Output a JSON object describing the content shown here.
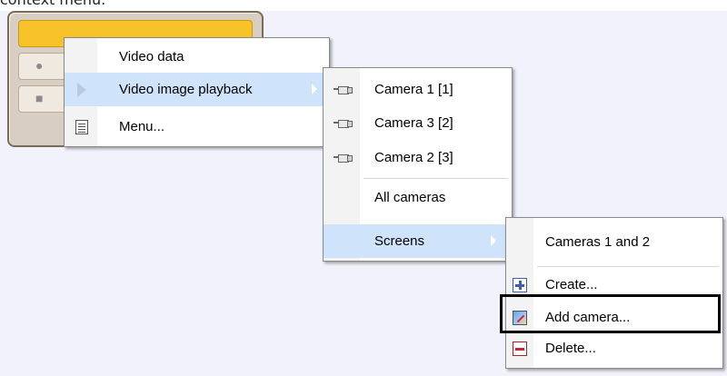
{
  "doc": {
    "caption": "context menu."
  },
  "menu_main": {
    "items": [
      {
        "label": "Video data",
        "icon": "none"
      },
      {
        "label": "Video image playback",
        "icon": "play-icon",
        "submenu": true,
        "highlighted": true
      },
      {
        "label": "Menu...",
        "icon": "menu-icon"
      }
    ]
  },
  "menu_cameras": {
    "items": [
      {
        "label": "Camera 1 [1]",
        "icon": "camera-icon"
      },
      {
        "label": "Camera 3 [2]",
        "icon": "camera-icon"
      },
      {
        "label": "Camera 2 [3]",
        "icon": "camera-icon"
      },
      {
        "label": "All cameras",
        "icon": "none"
      },
      {
        "label": "Screens",
        "icon": "none",
        "submenu": true,
        "highlighted": true
      }
    ]
  },
  "menu_screens": {
    "items": [
      {
        "label": "Cameras 1 and 2",
        "icon": "none"
      },
      {
        "label": "Create...",
        "icon": "plus-icon"
      },
      {
        "label": "Add camera...",
        "icon": "edit-camera-icon",
        "emphasized": true
      },
      {
        "label": "Delete...",
        "icon": "minus-icon"
      }
    ]
  },
  "colors": {
    "highlight": "#cfe3fb",
    "panel_active": "#f7c22a",
    "desktop_bg": "#f1f2fb"
  }
}
